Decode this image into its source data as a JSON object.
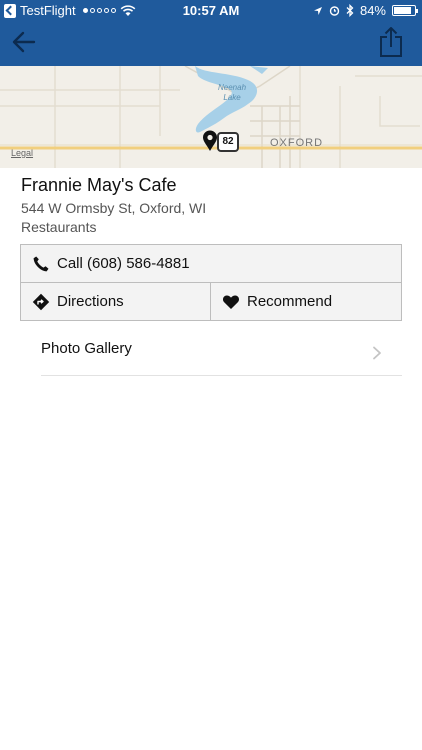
{
  "status_bar": {
    "carrier": "TestFlight",
    "time": "10:57 AM",
    "battery": "84%",
    "battery_level": 0.84
  },
  "nav": {
    "back_icon": "arrow-left-icon",
    "share_icon": "share-icon"
  },
  "map": {
    "lake_label": "Neenah\nLake",
    "route_number": "82",
    "town_label": "OXFORD",
    "legal": "Legal"
  },
  "place": {
    "name": "Frannie May's Cafe",
    "address": "544 W Ormsby St, Oxford, WI",
    "category": "Restaurants"
  },
  "actions": {
    "call": "Call (608) 586-4881",
    "directions": "Directions",
    "recommend": "Recommend"
  },
  "gallery": {
    "label": "Photo Gallery"
  },
  "colors": {
    "header": "#1f5a9c",
    "map_bg": "#f2efe8",
    "lake": "#a7d0e8",
    "road": "#f1cf7e"
  }
}
